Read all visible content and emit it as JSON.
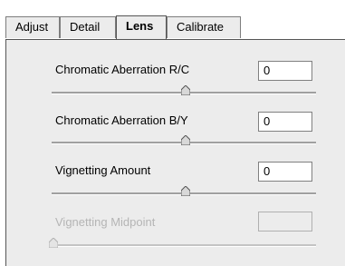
{
  "tabs": [
    {
      "label": "Adjust"
    },
    {
      "label": "Detail"
    },
    {
      "label": "Lens"
    },
    {
      "label": "Calibrate"
    }
  ],
  "active_tab": "Lens",
  "controls": [
    {
      "label": "Chromatic Aberration R/C",
      "value": "0",
      "enabled": true,
      "slider_position": 0.5
    },
    {
      "label": "Chromatic Aberration B/Y",
      "value": "0",
      "enabled": true,
      "slider_position": 0.5
    },
    {
      "label": "Vignetting Amount",
      "value": "0",
      "enabled": true,
      "slider_position": 0.5
    },
    {
      "label": "Vignetting Midpoint",
      "value": "",
      "enabled": false,
      "slider_position": 0
    }
  ]
}
